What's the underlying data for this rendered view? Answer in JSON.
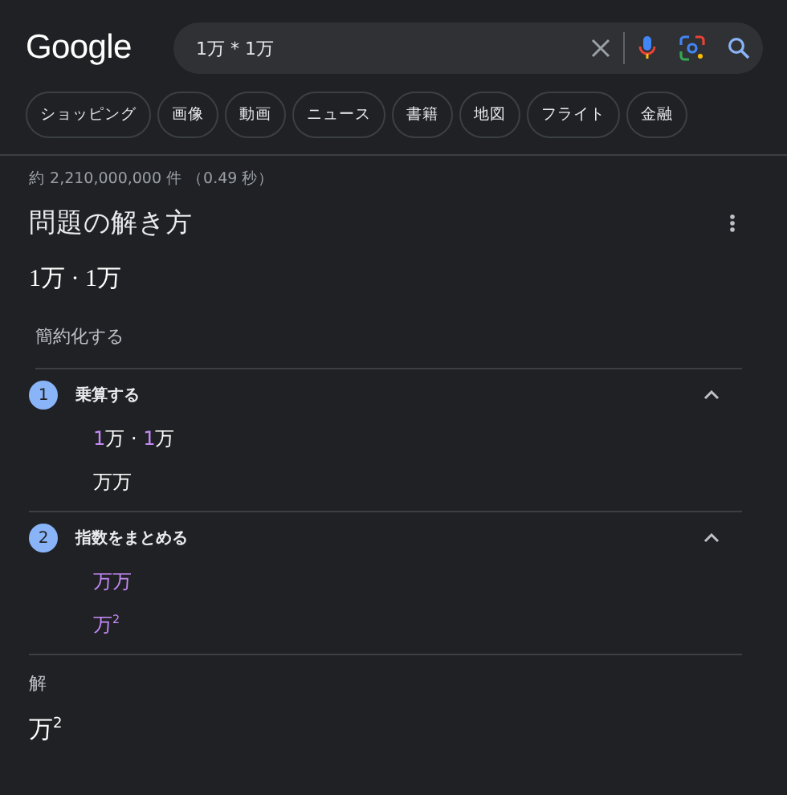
{
  "header": {
    "logo": "Google",
    "search": {
      "value": "1万 * 1万"
    }
  },
  "filters": [
    {
      "label": "ショッピング"
    },
    {
      "label": "画像"
    },
    {
      "label": "動画"
    },
    {
      "label": "ニュース"
    },
    {
      "label": "書籍"
    },
    {
      "label": "地図"
    },
    {
      "label": "フライト"
    },
    {
      "label": "金融"
    }
  ],
  "result_stats": "約 2,210,000,000 件 （0.49 秒）",
  "solver": {
    "title": "問題の解き方",
    "problem": "1万 · 1万",
    "method": "簡約化する",
    "steps": [
      {
        "number": "1",
        "title": "乗算する",
        "expanded": true,
        "lines": [
          {
            "segments": [
              {
                "text": "1",
                "highlight": true
              },
              {
                "text": "万 · ",
                "highlight": false
              },
              {
                "text": "1",
                "highlight": true
              },
              {
                "text": "万",
                "highlight": false
              }
            ]
          },
          {
            "segments": [
              {
                "text": "万万",
                "highlight": false
              }
            ]
          }
        ]
      },
      {
        "number": "2",
        "title": "指数をまとめる",
        "expanded": true,
        "lines": [
          {
            "segments": [
              {
                "text": "万万",
                "highlight": true
              }
            ]
          },
          {
            "segments": [
              {
                "text": "万$^{2}$",
                "highlight": true
              }
            ]
          }
        ]
      }
    ],
    "answer_label": "解",
    "answer": "万$^{2}$"
  }
}
